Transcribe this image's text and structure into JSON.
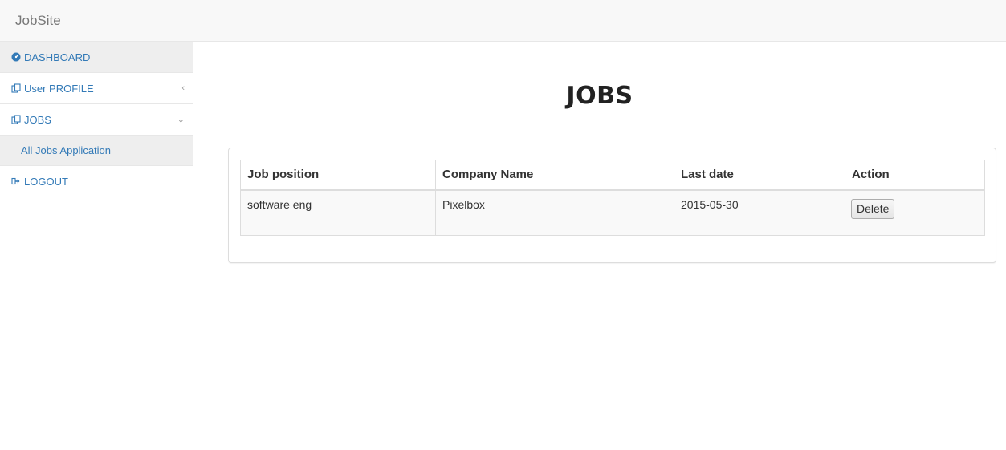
{
  "app": {
    "brand": "JobSite"
  },
  "sidebar": {
    "items": [
      {
        "label": "DASHBOARD",
        "icon": "dashboard-icon"
      },
      {
        "label": "User PROFILE",
        "icon": "files-icon",
        "arrow": "‹"
      },
      {
        "label": "JOBS",
        "icon": "files-icon",
        "arrow": "⌄"
      },
      {
        "label": "All Jobs Application"
      },
      {
        "label": "LOGOUT",
        "icon": "sign-out-icon"
      }
    ]
  },
  "main": {
    "title": "JOBS",
    "table": {
      "headers": [
        "Job position",
        "Company Name",
        "Last date",
        "Action"
      ],
      "rows": [
        {
          "position": "software eng",
          "company": "Pixelbox",
          "last_date": "2015-05-30",
          "action": "Delete"
        }
      ]
    }
  },
  "colors": {
    "link": "#337ab7",
    "navbar_bg": "#f8f8f8",
    "active_bg": "#eeeeee",
    "border": "#dddddd"
  }
}
